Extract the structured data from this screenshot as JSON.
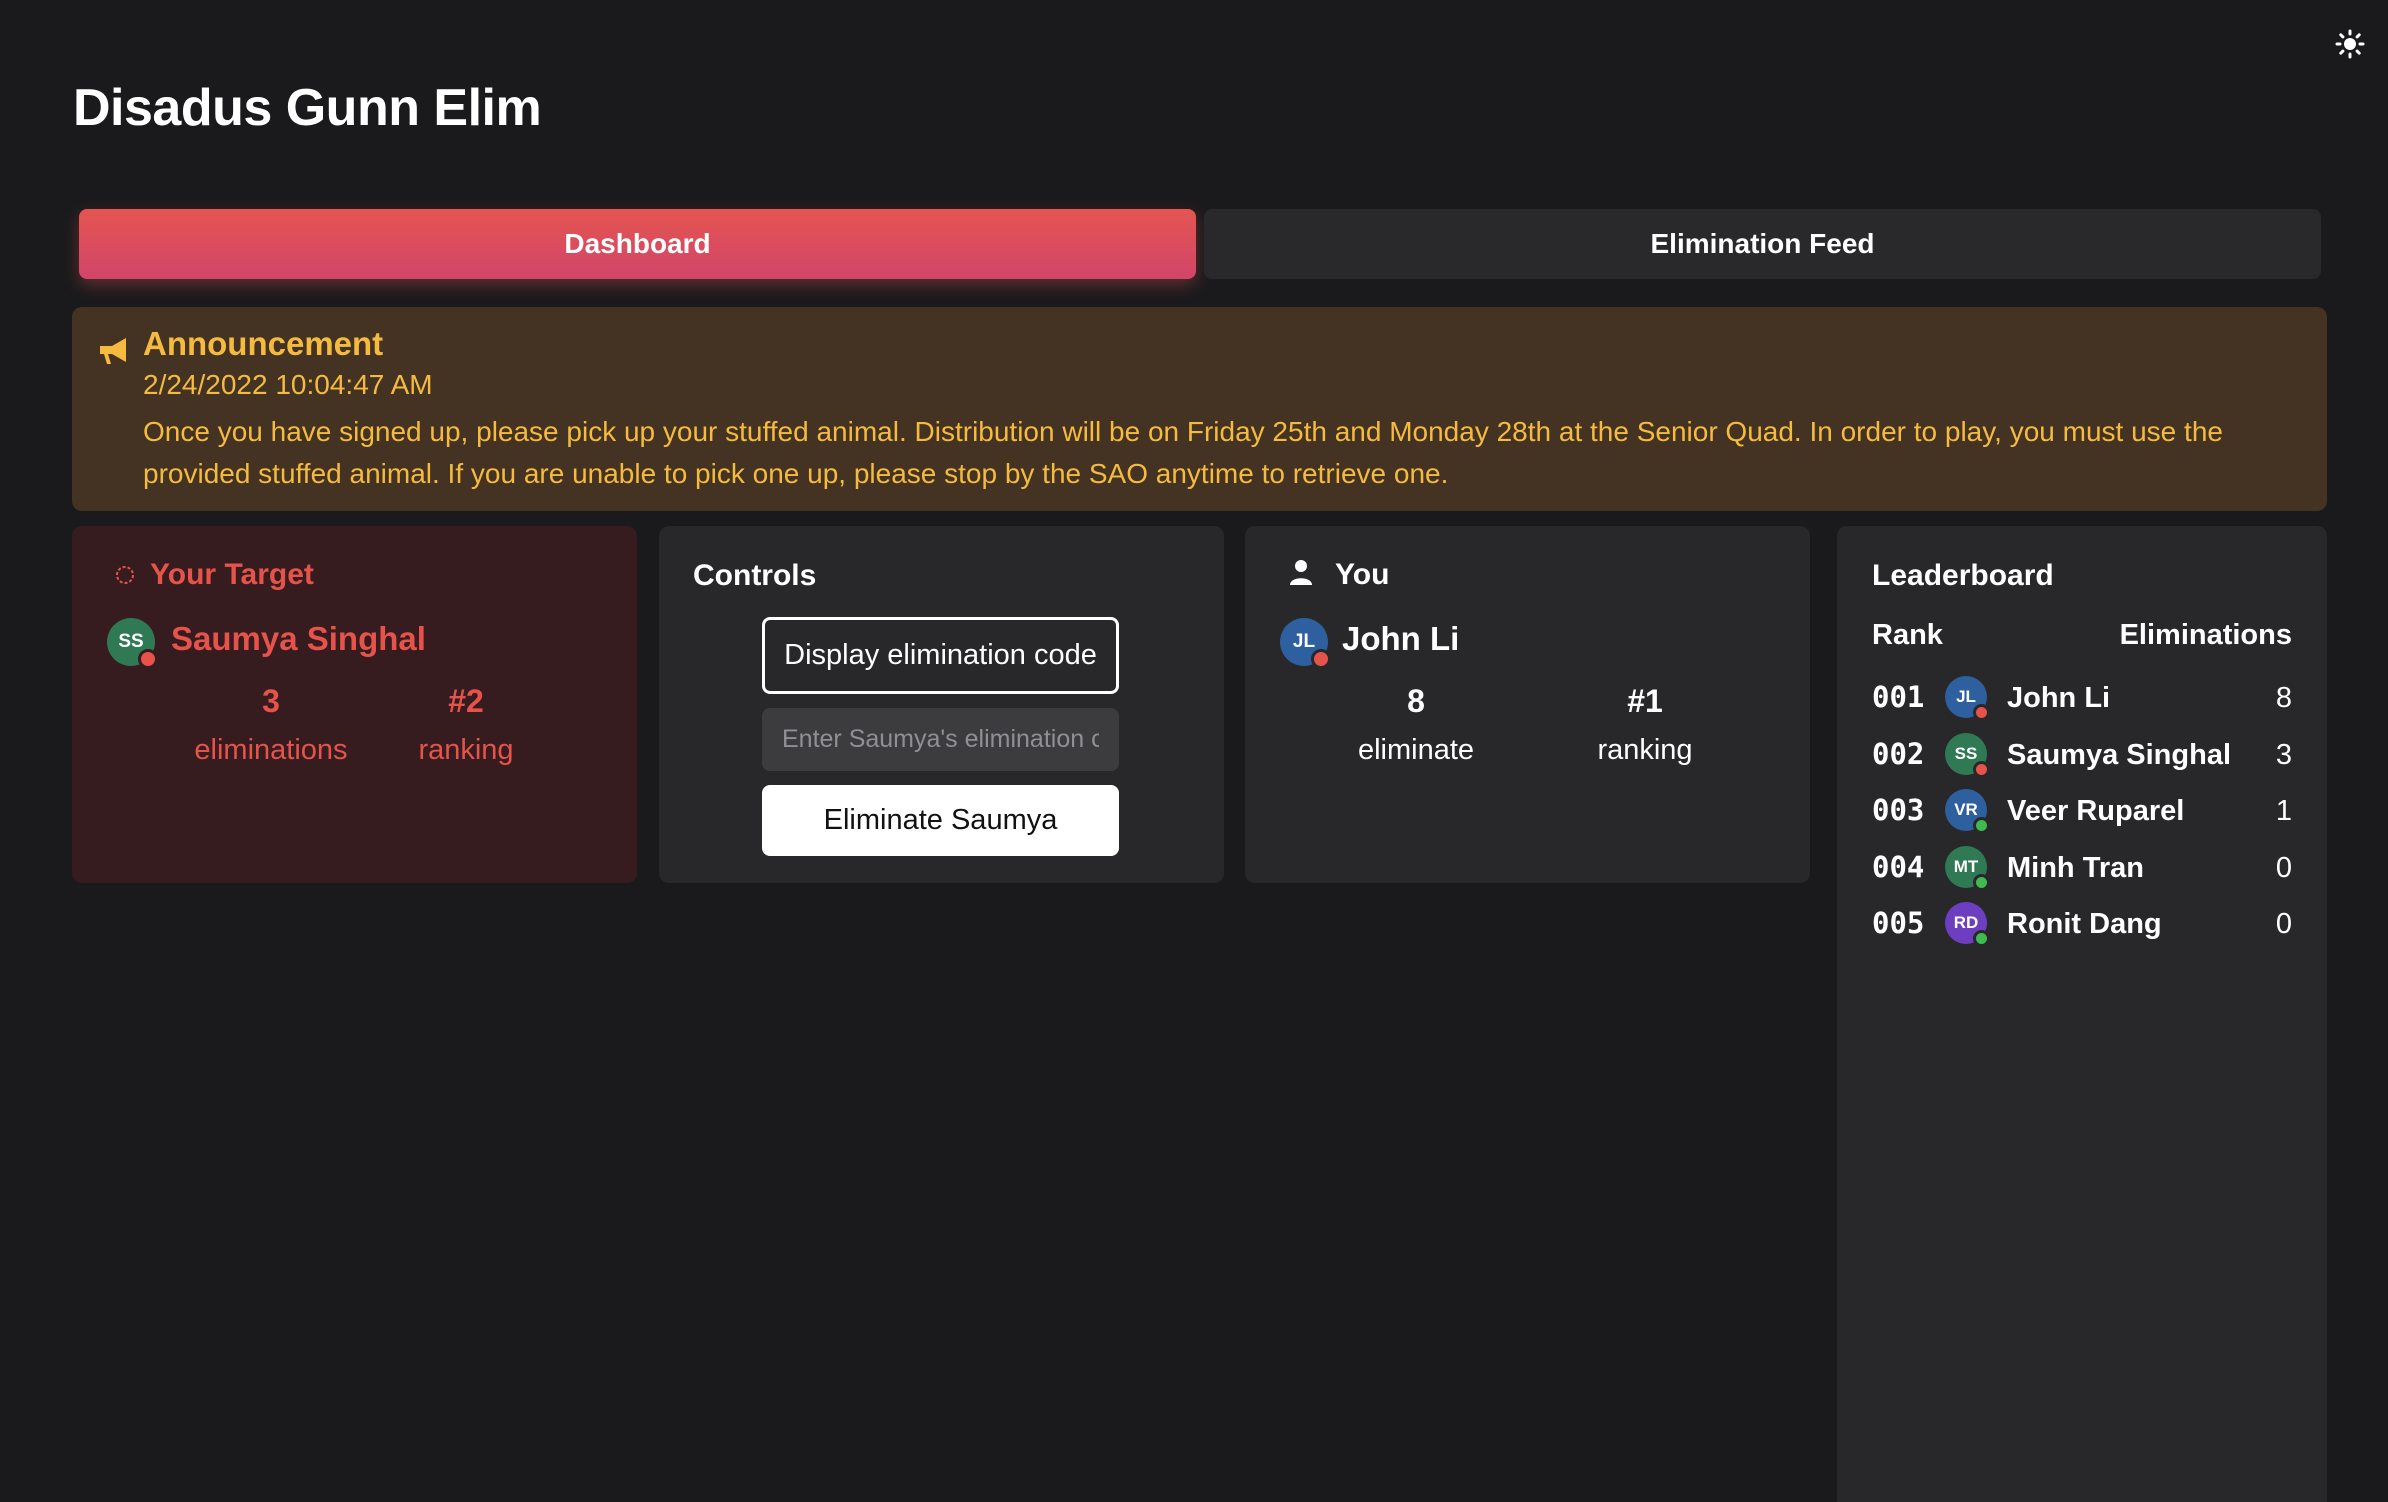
{
  "app": {
    "title": "Disadus Gunn Elim",
    "theme_toggle_icon": "sun-icon"
  },
  "tabs": [
    {
      "label": "Dashboard",
      "active": true
    },
    {
      "label": "Elimination Feed",
      "active": false
    }
  ],
  "announcement": {
    "icon": "megaphone-icon",
    "title": "Announcement",
    "date": "2/24/2022 10:04:47 AM",
    "body": "Once you have signed up, please pick up your stuffed animal. Distribution will be on Friday 25th and Monday 28th at the Senior Quad. In order to play, you must use the provided stuffed animal. If you are unable to pick one up, please stop by the SAO anytime to retrieve one."
  },
  "target": {
    "icon": "crosshair-icon",
    "heading": "Your Target",
    "initials": "SS",
    "name": "Saumya Singhal",
    "eliminations_value": "3",
    "eliminations_label": "eliminations",
    "ranking_value": "#2",
    "ranking_label": "ranking"
  },
  "controls": {
    "heading": "Controls",
    "display_code_label": "Display elimination code",
    "code_placeholder": "Enter Saumya's elimination code",
    "eliminate_label": "Eliminate Saumya"
  },
  "you": {
    "icon": "user-icon",
    "heading": "You",
    "initials": "JL",
    "name": "John Li",
    "eliminations_value": "8",
    "eliminations_label": "eliminate",
    "ranking_value": "#1",
    "ranking_label": "ranking"
  },
  "leaderboard": {
    "heading": "Leaderboard",
    "rank_header": "Rank",
    "elims_header": "Eliminations",
    "rows": [
      {
        "rank": "001",
        "initials": "JL",
        "name": "John Li",
        "eliminations": "8",
        "avatar_color": "#2e5f9e",
        "status_color": "#e5534b"
      },
      {
        "rank": "002",
        "initials": "SS",
        "name": "Saumya Singhal",
        "eliminations": "3",
        "avatar_color": "#2f7a55",
        "status_color": "#e5534b"
      },
      {
        "rank": "003",
        "initials": "VR",
        "name": "Veer Ruparel",
        "eliminations": "1",
        "avatar_color": "#2e5f9e",
        "status_color": "#3fb950"
      },
      {
        "rank": "004",
        "initials": "MT",
        "name": "Minh Tran",
        "eliminations": "0",
        "avatar_color": "#2f7a55",
        "status_color": "#3fb950"
      },
      {
        "rank": "005",
        "initials": "RD",
        "name": "Ronit Dang",
        "eliminations": "0",
        "avatar_color": "#6d3fc0",
        "status_color": "#3fb950"
      }
    ]
  },
  "colors": {
    "background": "#1a1a1c",
    "card": "#28282b",
    "accent_red": "#e5534b",
    "announcement_text": "#f4bb3f",
    "announcement_bg": "#443222"
  }
}
